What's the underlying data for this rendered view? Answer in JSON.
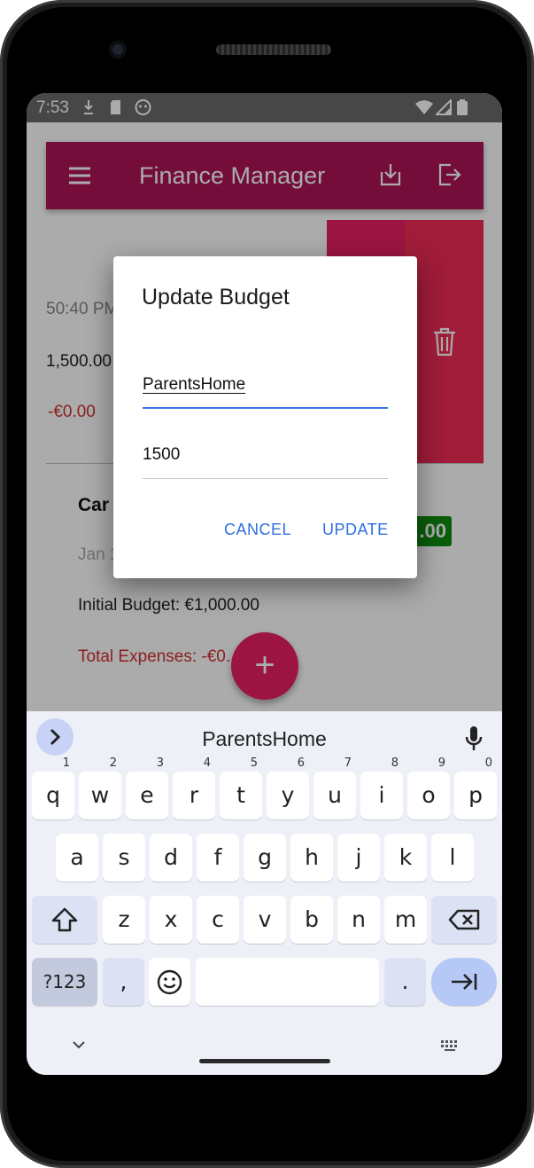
{
  "status_bar": {
    "time": "7:53"
  },
  "app_bar": {
    "title": "Finance Manager"
  },
  "background_card_1": {
    "time": "50:40 PM",
    "budget": "1,500.00",
    "expenses": "-€0.00"
  },
  "background_card_2": {
    "name": "Car",
    "date": "Jan 1",
    "badge": ".00",
    "initial_budget": "Initial Budget: €1,000.00",
    "total_expenses": "Total Expenses: -€0."
  },
  "dialog": {
    "title": "Update Budget",
    "name_value": "ParentsHome",
    "amount_value": "1500",
    "cancel_label": "CANCEL",
    "update_label": "UPDATE"
  },
  "fab": {
    "label": "+"
  },
  "keyboard": {
    "suggestion": "ParentsHome",
    "row1": [
      "q",
      "w",
      "e",
      "r",
      "t",
      "y",
      "u",
      "i",
      "o",
      "p"
    ],
    "row1_hints": [
      "1",
      "2",
      "3",
      "4",
      "5",
      "6",
      "7",
      "8",
      "9",
      "0"
    ],
    "row2": [
      "a",
      "s",
      "d",
      "f",
      "g",
      "h",
      "j",
      "k",
      "l"
    ],
    "row3": [
      "z",
      "x",
      "c",
      "v",
      "b",
      "n",
      "m"
    ],
    "symbols_label": "?123",
    "comma_label": ",",
    "period_label": "."
  },
  "colors": {
    "app_bar": "#ad1457",
    "accent": "#e91e63",
    "dialog_button": "#2f6fe0",
    "expense_red": "#d32f2f",
    "badge_green": "#108c10"
  }
}
